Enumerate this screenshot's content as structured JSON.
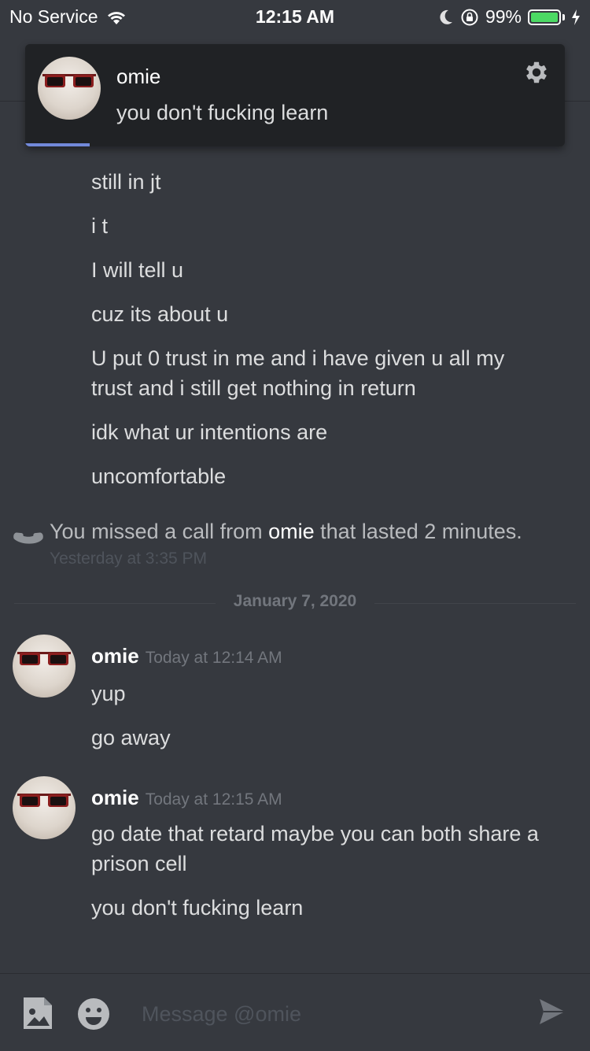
{
  "status_bar": {
    "carrier": "No Service",
    "time": "12:15 AM",
    "battery": "99%",
    "battery_level": 0.99
  },
  "toast": {
    "name": "omie",
    "message": "you don't fucking learn",
    "progress": 0.12
  },
  "messages_prev": [
    "still in jt",
    "i t",
    "I will tell u",
    "cuz its about u",
    "U put 0 trust in me and i have given u all my",
    "trust and i still get nothing in return",
    "idk what ur intentions are",
    "uncomfortable"
  ],
  "missed_call": {
    "prefix": "You missed a call from ",
    "user": "omie",
    "suffix": " that lasted 2 minutes.",
    "time": "Yesterday at 3:35 PM"
  },
  "date_divider": "January 7, 2020",
  "groups": [
    {
      "author": "omie",
      "time": "Today at 12:14 AM",
      "lines": [
        "yup",
        "go away"
      ]
    },
    {
      "author": "omie",
      "time": "Today at 12:15 AM",
      "lines": [
        "go date that retard maybe you can both share a",
        "prison cell",
        "you don't fucking learn"
      ]
    }
  ],
  "input": {
    "placeholder": "Message @omie"
  },
  "colors": {
    "background": "#36393f",
    "toast_bg": "#202225",
    "accent": "#7289da",
    "battery": "#4cd964"
  }
}
